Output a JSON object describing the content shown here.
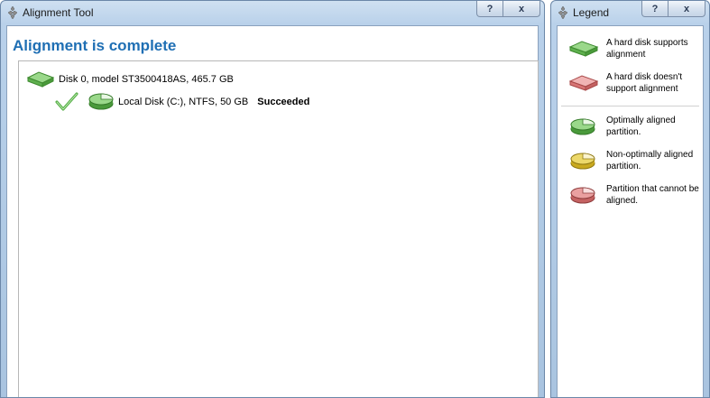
{
  "main_window": {
    "title": "Alignment Tool",
    "help_button": "?",
    "close_button": "x",
    "heading": "Alignment is complete",
    "disk": {
      "label": "Disk 0, model ST3500418AS, 465.7 GB"
    },
    "partition": {
      "label": "Local Disk (C:), NTFS, 50 GB",
      "status": "Succeeded"
    }
  },
  "legend_window": {
    "title": "Legend",
    "help_button": "?",
    "close_button": "x",
    "items": [
      {
        "icon": "green-disk-icon",
        "color": "#5db34a",
        "text": "A hard disk supports alignment"
      },
      {
        "icon": "red-disk-icon",
        "color": "#d77575",
        "text": "A hard disk doesn't support alignment"
      },
      {
        "icon": "green-partition-icon",
        "color": "#5db34a",
        "text": "Optimally aligned partition."
      },
      {
        "icon": "yellow-partition-icon",
        "color": "#d9bf33",
        "text": "Non-optimally aligned partition."
      },
      {
        "icon": "red-partition-icon",
        "color": "#d77575",
        "text": "Partition that cannot be aligned."
      }
    ]
  },
  "colors": {
    "heading": "#1f6fb4",
    "check": "#4aa83a"
  }
}
